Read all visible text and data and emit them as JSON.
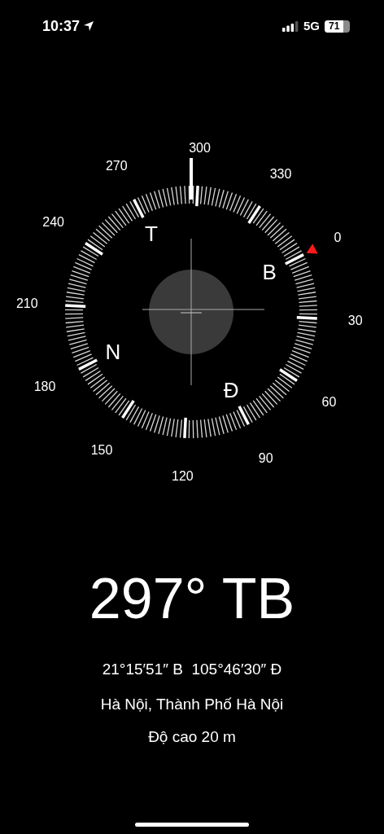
{
  "status_bar": {
    "time": "10:37",
    "network": "5G",
    "battery": "71"
  },
  "compass": {
    "scale_labels": [
      "0",
      "30",
      "60",
      "90",
      "120",
      "150",
      "180",
      "210",
      "240",
      "270",
      "300",
      "330"
    ],
    "cardinal_labels": [
      "B",
      "Đ",
      "N",
      "T"
    ]
  },
  "heading": "297° TB",
  "coordinates": "21°15′51″ B  105°46′30″ Đ",
  "location": "Hà Nội, Thành Phố Hà Nội",
  "altitude": "Độ cao 20 m"
}
